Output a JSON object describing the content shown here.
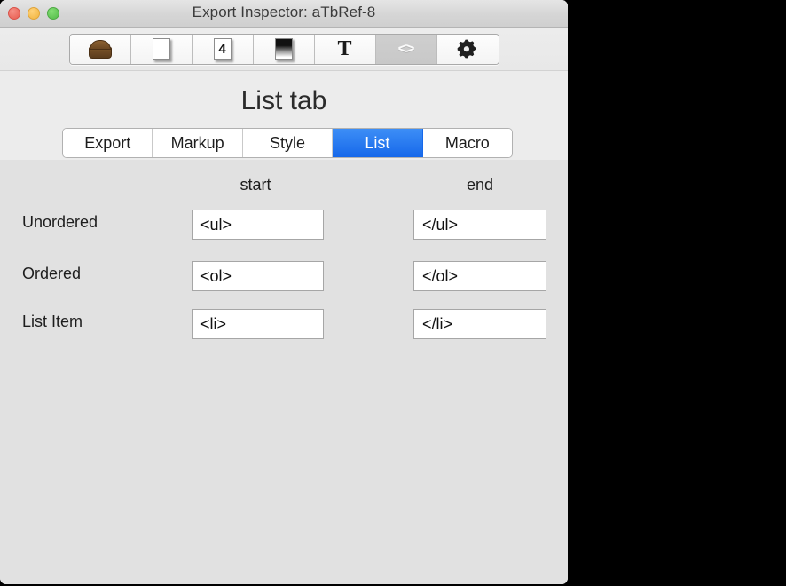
{
  "window": {
    "title": "Export Inspector: aTbRef-8",
    "traffic_lights": [
      {
        "name": "close",
        "color": "#ec6a5e"
      },
      {
        "name": "minimize",
        "color": "#f5bd4f"
      },
      {
        "name": "zoom",
        "color": "#61c555"
      }
    ]
  },
  "toolbar": {
    "segments": [
      {
        "name": "chest-icon",
        "glyph": "chest",
        "label": "",
        "selected": false
      },
      {
        "name": "page-icon",
        "glyph": "page",
        "label": "",
        "selected": false
      },
      {
        "name": "page-number-icon",
        "glyph": "page-number",
        "label": "4",
        "selected": false
      },
      {
        "name": "page-gradient-icon",
        "glyph": "page-gradient",
        "label": "",
        "selected": false
      },
      {
        "name": "text-icon",
        "glyph": "text",
        "label": "T",
        "selected": false
      },
      {
        "name": "code-icon",
        "glyph": "code",
        "label": "<>",
        "selected": true
      },
      {
        "name": "gear-icon",
        "glyph": "gear",
        "label": "",
        "selected": false
      }
    ]
  },
  "pane": {
    "title": "List tab"
  },
  "tabs": [
    {
      "label": "Export",
      "active": false
    },
    {
      "label": "Markup",
      "active": false
    },
    {
      "label": "Style",
      "active": false
    },
    {
      "label": "List",
      "active": true
    },
    {
      "label": "Macro",
      "active": false
    }
  ],
  "table": {
    "column_headers": {
      "start": "start",
      "end": "end"
    },
    "rows": [
      {
        "label": "Unordered",
        "start": "<ul>",
        "end": "</ul>"
      },
      {
        "label": "Ordered",
        "start": "<ol>",
        "end": "</ol>"
      },
      {
        "label": "List Item",
        "start": "<li>",
        "end": "</li>"
      }
    ]
  },
  "colors": {
    "accent": "#1668ea",
    "window_bg": "#ececec",
    "content_bg": "#e1e1e1",
    "field_bg": "#ffffff",
    "text": "#1d1d1d"
  }
}
